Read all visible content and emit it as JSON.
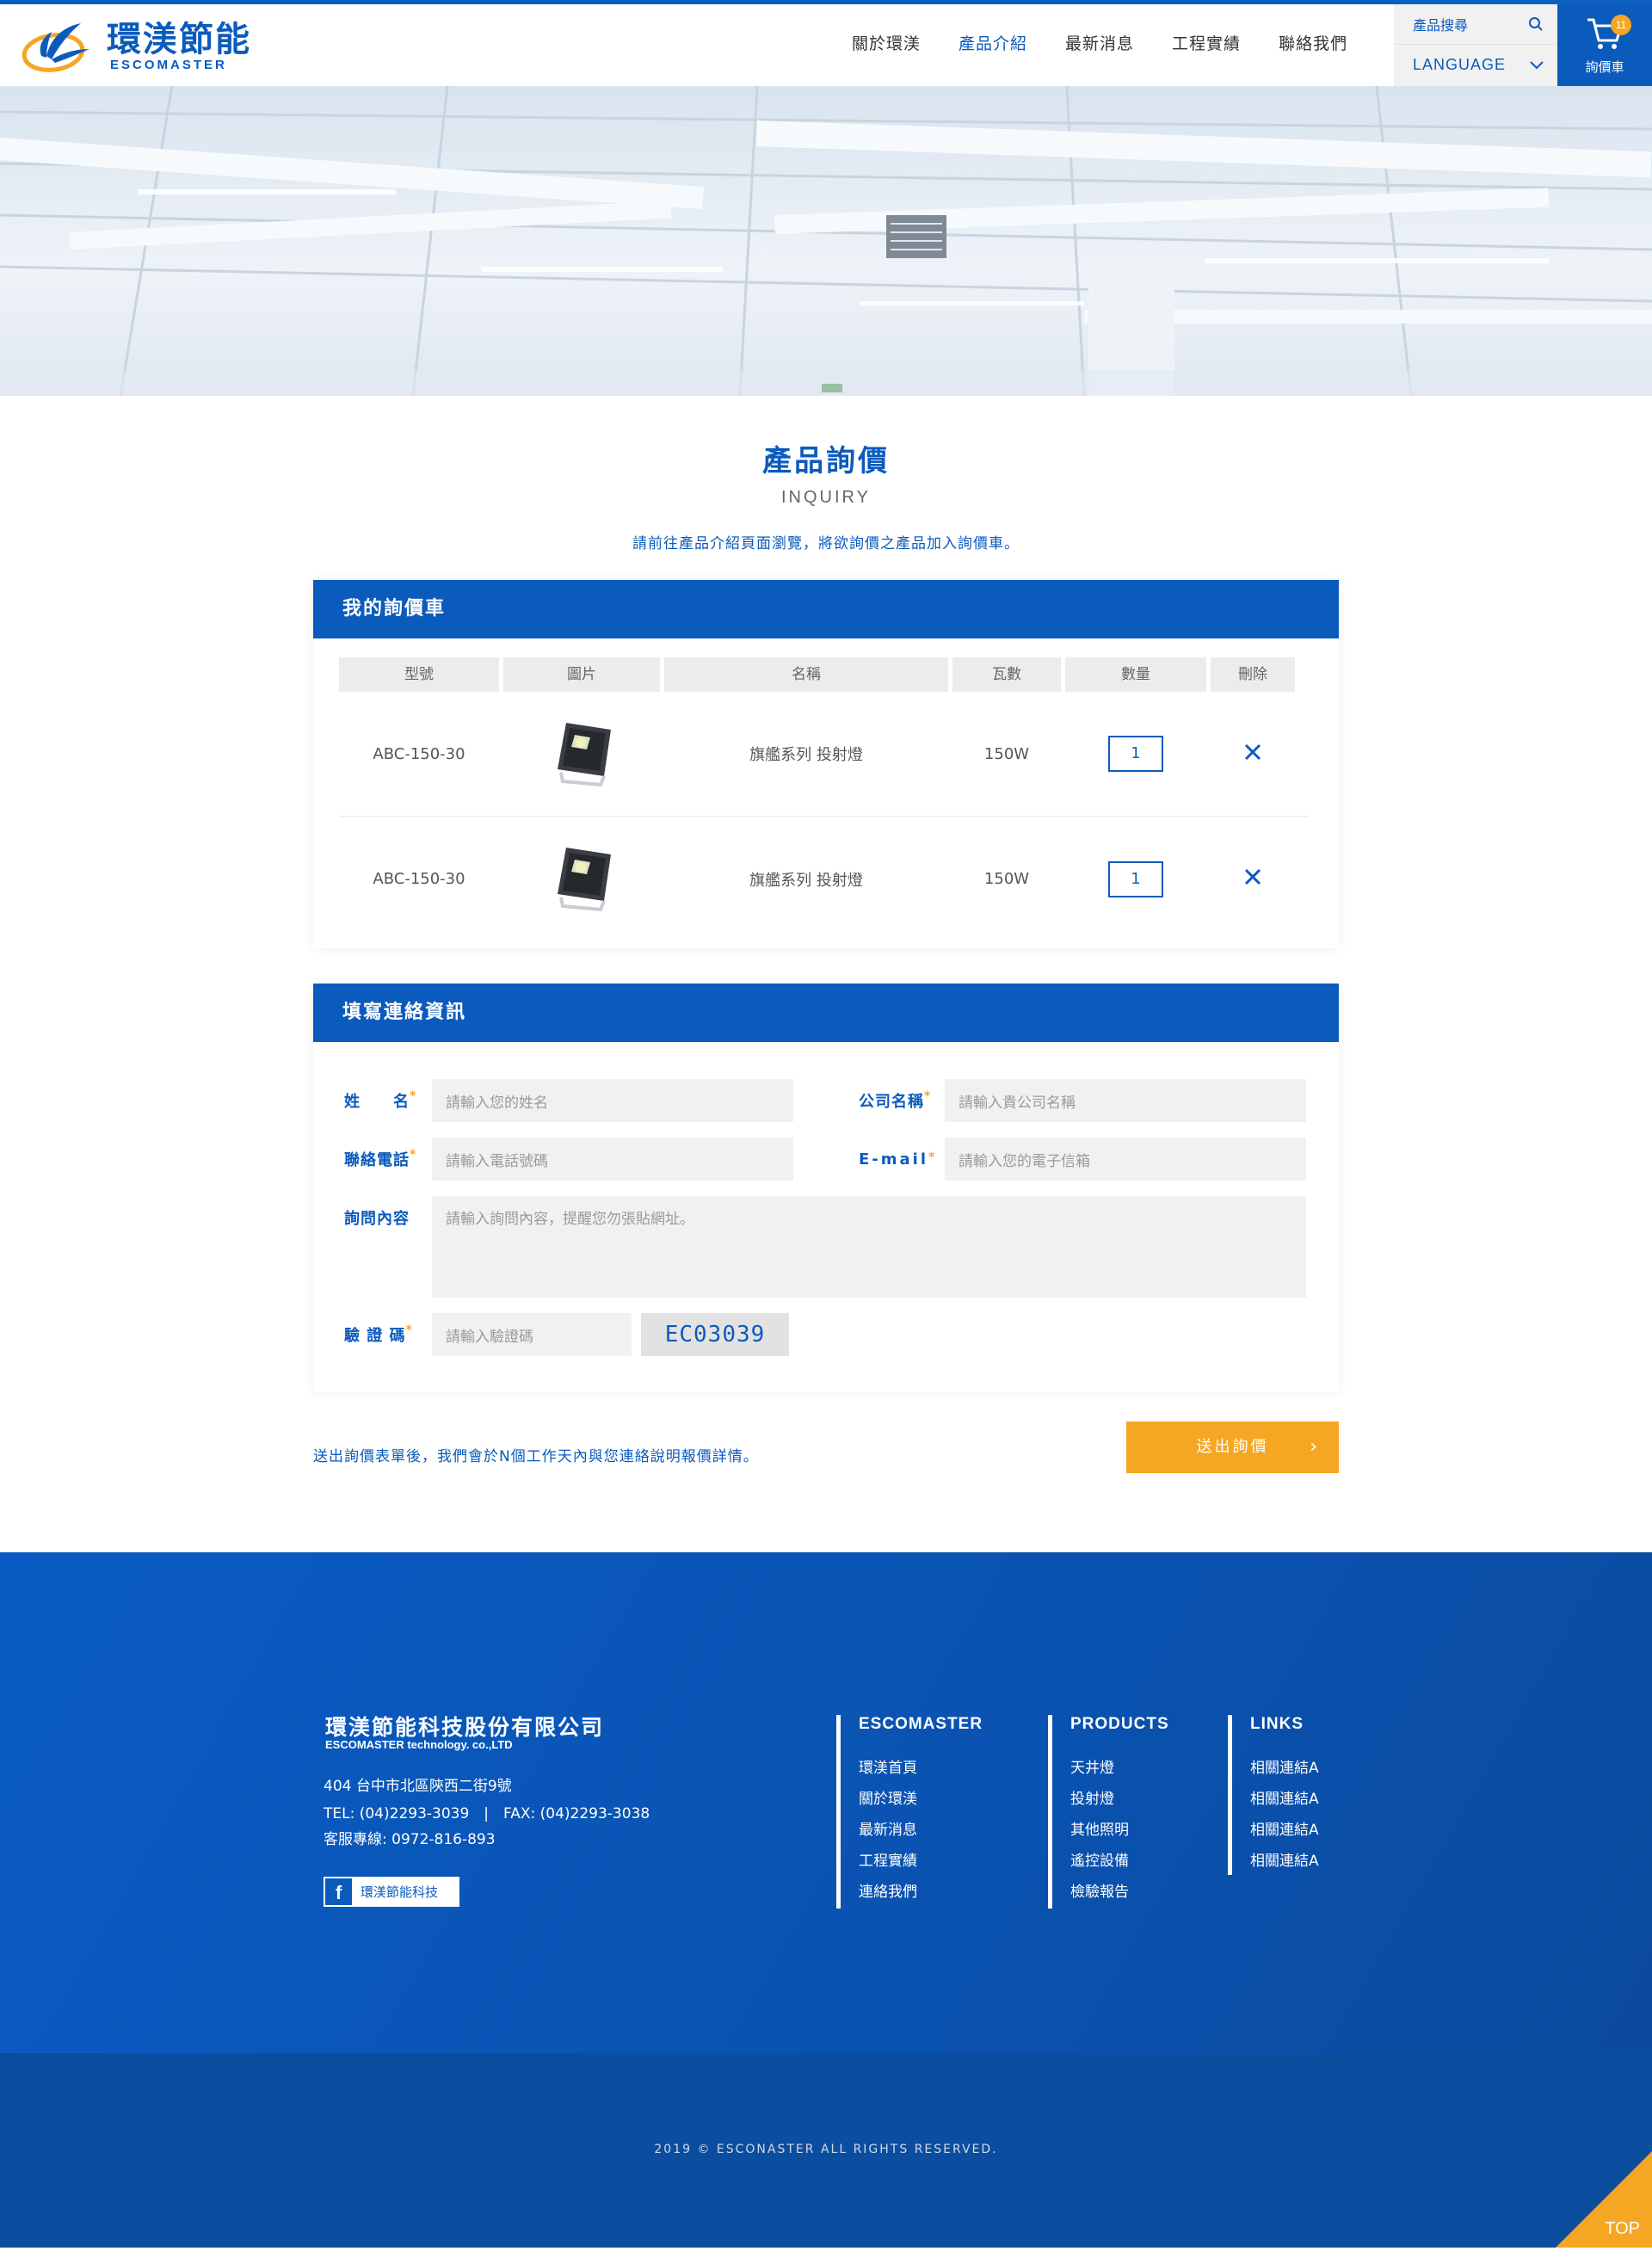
{
  "brand": {
    "name_cn": "環渼節能",
    "name_en": "ESCOMASTER"
  },
  "nav": {
    "items": [
      "關於環渼",
      "產品介紹",
      "最新消息",
      "工程實績",
      "聯絡我們"
    ],
    "active": "產品介紹"
  },
  "tools": {
    "search_label": "產品搜尋",
    "language_label": "LANGUAGE"
  },
  "cart": {
    "count": "11",
    "label": "詢價車"
  },
  "page": {
    "title_cn": "產品詢價",
    "title_en": "INQUIRY",
    "intro": "請前往產品介紹頁面瀏覽，將欲詢價之產品加入詢價車。"
  },
  "inquiry_cart": {
    "heading": "我的詢價車",
    "columns": [
      "型號",
      "圖片",
      "名稱",
      "瓦數",
      "數量",
      "刪除"
    ],
    "rows": [
      {
        "model": "ABC-150-30",
        "name": "旗艦系列 投射燈",
        "watt": "150W",
        "qty": "1"
      },
      {
        "model": "ABC-150-30",
        "name": "旗艦系列 投射燈",
        "watt": "150W",
        "qty": "1"
      }
    ],
    "delete_icon": "close-icon"
  },
  "contact_form": {
    "heading": "填寫連絡資訊",
    "name_label": "姓　　名",
    "name_placeholder": "請輸入您的姓名",
    "company_label": "公司名稱",
    "company_placeholder": "請輸入貴公司名稱",
    "phone_label": "聯絡電話",
    "phone_placeholder": "請輸入電話號碼",
    "email_label": "E-mail",
    "email_placeholder": "請輸入您的電子信箱",
    "message_label": "詢問內容",
    "message_placeholder": "請輸入詢問內容，提醒您勿張貼網址。",
    "captcha_label": "驗 證 碼",
    "captcha_placeholder": "請輸入驗證碼",
    "captcha_code": "EC03039",
    "required_mark": "*"
  },
  "submit": {
    "note": "送出詢價表單後，我們會於N個工作天內與您連絡說明報價詳情。",
    "button_label": "送出詢價",
    "arrow": "›"
  },
  "footer": {
    "company_cn": "環渼節能科技股份有限公司",
    "company_en": "ESCOMASTER technology. co.,LTD",
    "address": "404 台中市北區陝西二街9號",
    "tel_fax": "TEL: (04)2293-3039　|　FAX: (04)2293-3038",
    "hotline": "客服專線: 0972-816-893",
    "facebook_label": "環渼節能科技",
    "columns": [
      {
        "title": "ESCOMASTER",
        "links": [
          "環渼首頁",
          "關於環渼",
          "最新消息",
          "工程實績",
          "連絡我們"
        ]
      },
      {
        "title": "PRODUCTS",
        "links": [
          "天井燈",
          "投射燈",
          "其他照明",
          "遙控設備",
          "檢驗報告"
        ]
      },
      {
        "title": "LINKS",
        "links": [
          "相關連結A",
          "相關連結A",
          "相關連結A",
          "相關連結A"
        ]
      }
    ],
    "copyright": "2019 © ESCONASTER ALL RIGHTS RESERVED.",
    "top_label": "TOP"
  },
  "colors": {
    "primary": "#0b5bbd",
    "accent": "#f5a623",
    "footer": "#0a52b0"
  }
}
